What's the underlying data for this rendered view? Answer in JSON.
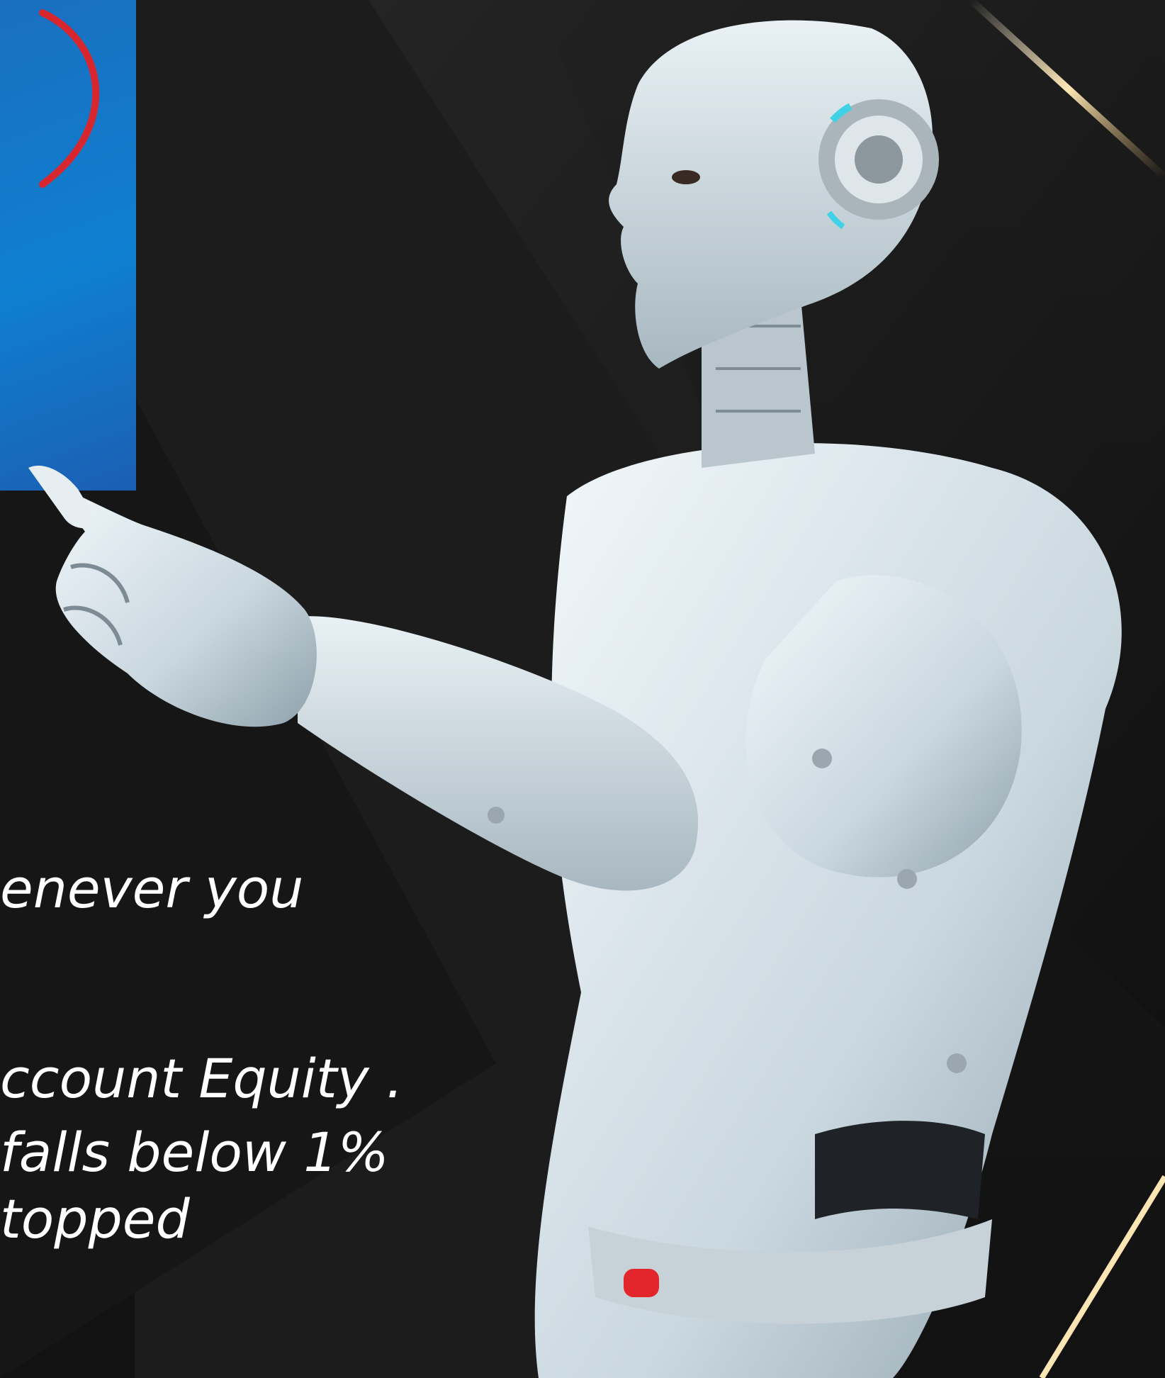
{
  "text_lines": [
    "enever you",
    "ccount Equity .",
    "falls below 1%",
    "topped"
  ],
  "colors": {
    "background": "#141414",
    "panel_blue": "#0f7fd0",
    "panel_arc": "#d8262e",
    "robot_body": "#d6e3ea",
    "accent_cyan": "#3fd2e6",
    "accent_red": "#e3262c",
    "text": "#ffffff"
  },
  "scene": {
    "subject": "humanoid-robot-icon",
    "panel": "blue-panel-with-red-arc"
  }
}
